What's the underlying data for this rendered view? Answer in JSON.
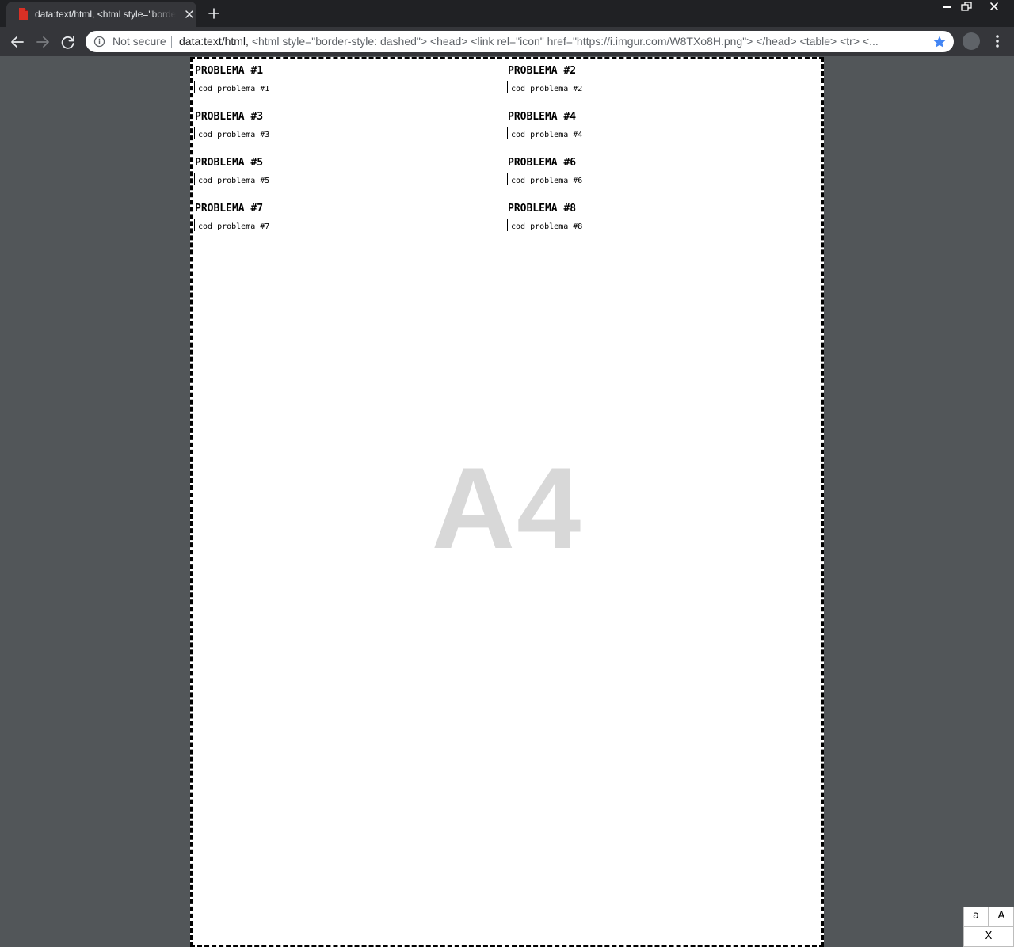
{
  "tab": {
    "title": "data:text/html, <html style=\"border-style: dashed\"> <head>",
    "close_icon": "close-icon",
    "favicon_color": "#d93025"
  },
  "toolbar": {
    "security_label": "Not secure",
    "url_prefix": "data:text/html,",
    "url_rest": " <html style=\"border-style: dashed\"> <head> <link rel=\"icon\" href=\"https://i.imgur.com/W8TXo8H.png\"> </head> <table> <tr> <...",
    "star_color": "#4285f4"
  },
  "problems": [
    {
      "title": "PROBLEMA #1",
      "code": "cod problema #1"
    },
    {
      "title": "PROBLEMA #2",
      "code": "cod problema #2"
    },
    {
      "title": "PROBLEMA #3",
      "code": "cod problema #3"
    },
    {
      "title": "PROBLEMA #4",
      "code": "cod problema #4"
    },
    {
      "title": "PROBLEMA #5",
      "code": "cod problema #5"
    },
    {
      "title": "PROBLEMA #6",
      "code": "cod problema #6"
    },
    {
      "title": "PROBLEMA #7",
      "code": "cod problema #7"
    },
    {
      "title": "PROBLEMA #8",
      "code": "cod problema #8"
    }
  ],
  "watermark": "A4",
  "font_controls": {
    "smaller_label": "a",
    "larger_label": "A",
    "close_label": "X"
  }
}
